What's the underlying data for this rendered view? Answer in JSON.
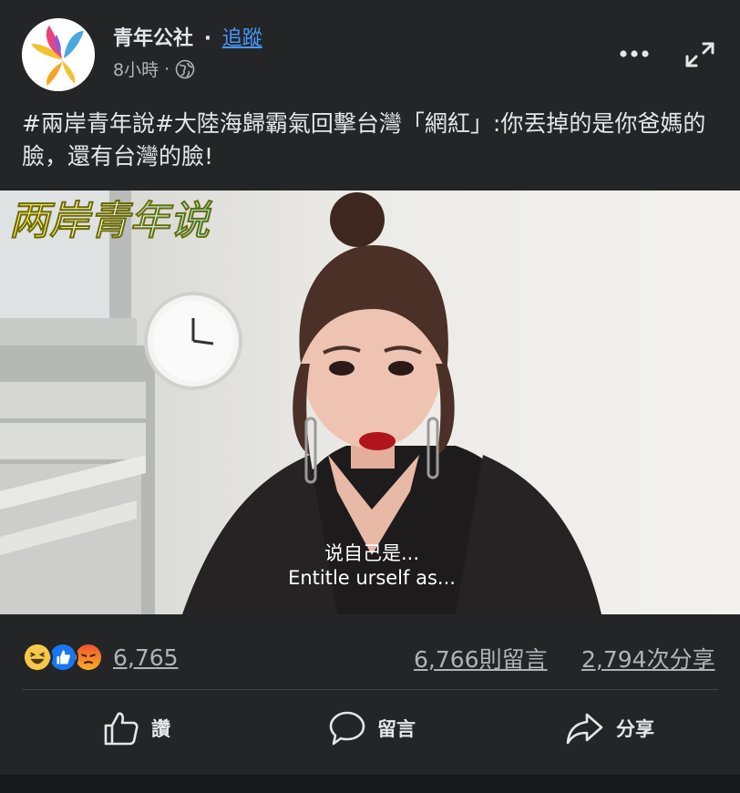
{
  "header": {
    "page_name": "青年公社",
    "separator": "·",
    "follow_label": "追蹤",
    "time": "8小時",
    "time_separator": "·",
    "privacy_icon": "globe-icon",
    "more_icon": "ellipsis-icon",
    "expand_icon": "expand-icon"
  },
  "post": {
    "text": "#兩岸青年說#大陸海歸霸氣回擊台灣「網紅」:你丟掉的是你爸媽的臉，還有台灣的臉!"
  },
  "video": {
    "logo_text": "两岸青年说",
    "subtitle_zh": "说自己是...",
    "subtitle_en": "Entitle urself as..."
  },
  "stats": {
    "reaction_icons": [
      "haha-icon",
      "like-icon",
      "angry-icon"
    ],
    "reaction_count": "6,765",
    "comment_count": "6,766則留言",
    "share_count": "2,794次分享"
  },
  "actions": {
    "like_label": "讚",
    "comment_label": "留言",
    "share_label": "分享"
  },
  "colors": {
    "background": "#242526",
    "link": "#4599ff",
    "secondary_text": "#b0b3b8"
  }
}
